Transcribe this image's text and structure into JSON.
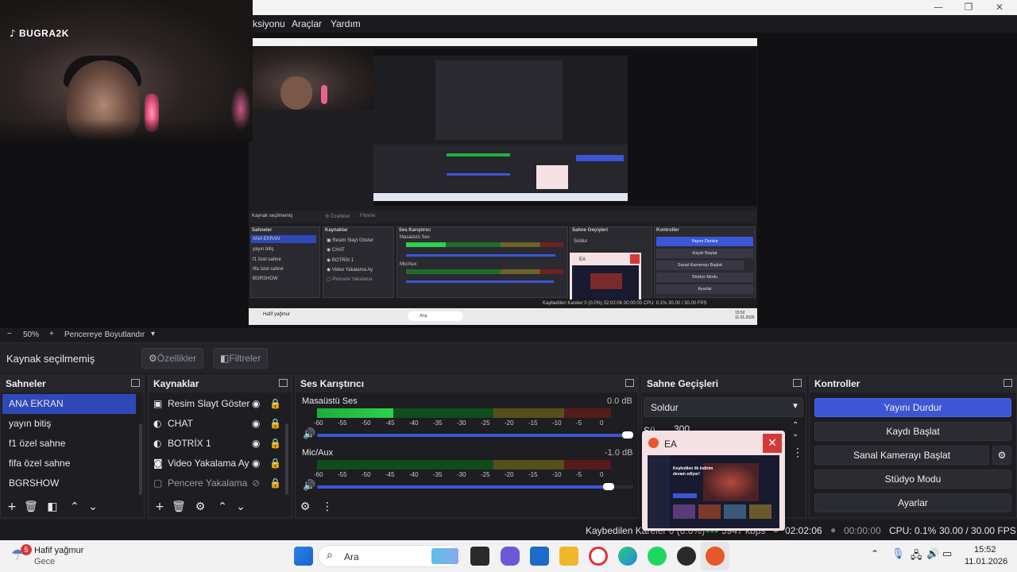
{
  "webcam": {
    "channel_name": "BUGRA2K"
  },
  "window": {
    "minimize": "—",
    "maximize": "❐",
    "close": "✕"
  },
  "menu": {
    "items": [
      "ksiyonu",
      "Araçlar",
      "Yardım"
    ]
  },
  "zoom": {
    "minus": "−",
    "value": "50%",
    "plus": "+",
    "mode": "Pencereye Boyutlandır",
    "dropdown": "▾"
  },
  "source_bar": {
    "status": "Kaynak seçilmemiş",
    "properties": "Özellikler",
    "filters": "Filtreler"
  },
  "scenes": {
    "title": "Sahneler",
    "items": [
      "ANA EKRAN",
      "yayın bitiş",
      "f1 özel sahne",
      "fifa özel sahne",
      "BGRSHOW"
    ],
    "selected_index": 0
  },
  "sources": {
    "title": "Kaynaklar",
    "items": [
      {
        "name": "Resim Slayt Göster",
        "icon": "slideshow-icon"
      },
      {
        "name": "CHAT",
        "icon": "globe-icon"
      },
      {
        "name": "BOTRİX 1",
        "icon": "globe-icon"
      },
      {
        "name": "Video Yakalama Ay",
        "icon": "camera-icon"
      },
      {
        "name": "Pencere Yakalama",
        "icon": "window-icon",
        "hidden": true
      }
    ]
  },
  "mixer": {
    "title": "Ses Karıştırıcı",
    "channels": [
      {
        "name": "Masaüstü Ses",
        "db": "0.0 dB",
        "level": 0.26,
        "volume": 1.0
      },
      {
        "name": "Mic/Aux",
        "db": "-1.0 dB",
        "level": 0.0,
        "volume": 0.94
      }
    ],
    "scale": [
      "-60",
      "-55",
      "-50",
      "-45",
      "-40",
      "-35",
      "-30",
      "-25",
      "-20",
      "-15",
      "-10",
      "-5",
      "0"
    ]
  },
  "transitions": {
    "title": "Sahne Geçişleri",
    "selected": "Soldur",
    "duration_label": "Sü",
    "duration_value": "300"
  },
  "controls": {
    "title": "Kontroller",
    "buttons": [
      "Yayını Durdur",
      "Kaydı Başlat",
      "Sanal Kamerayı Başlat",
      "Stüdyo Modu",
      "Ayarlar"
    ]
  },
  "status": {
    "dropped": "Kaybedilen Kareler 0 (0.0%)",
    "bitrate": "5947 kbps",
    "live_time": "02:02:06",
    "rec_time": "00:00:00",
    "cpu": "CPU: 0.1%",
    "fps": "30.00 / 30.00 FPS"
  },
  "ea_popup": {
    "title": "EA",
    "headline": "Keşfedilen ilk indirim devam ediyor!"
  },
  "taskbar": {
    "weather_badge": "5",
    "weather_title": "Hafif yağmur",
    "weather_sub": "Gece",
    "search_placeholder": "Ara",
    "time": "15:52",
    "date": "11.01.2026"
  },
  "colors": {
    "accent": "#3c56d6",
    "close_red": "#d23a3a"
  }
}
